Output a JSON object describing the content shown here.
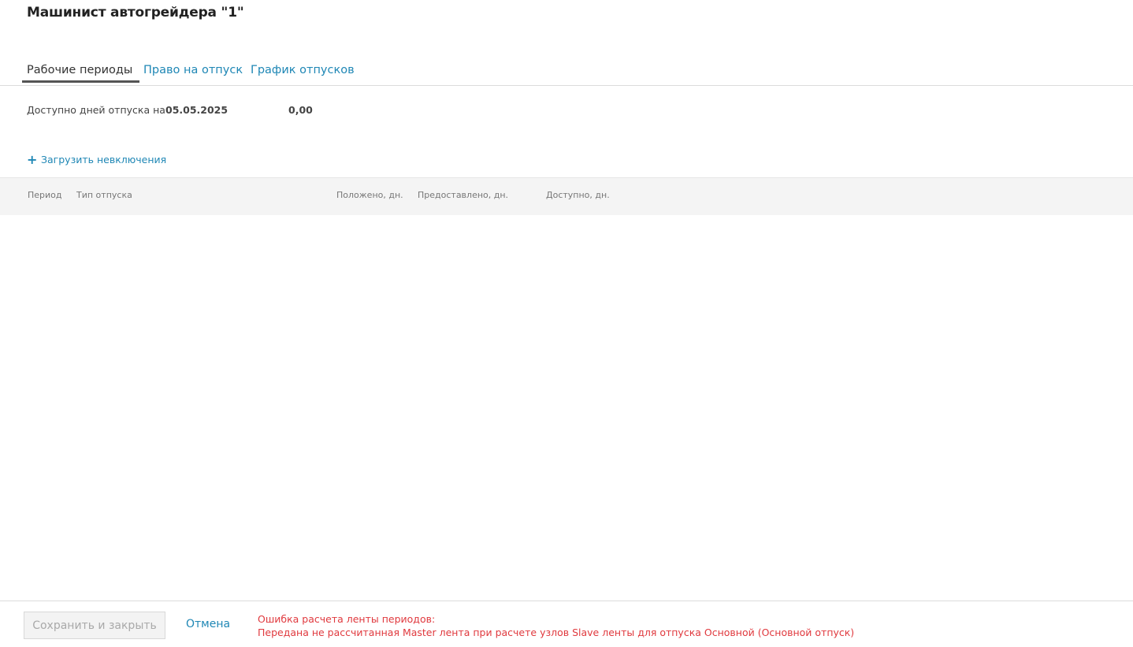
{
  "header": {
    "title": "Машинист автогрейдера \"1\""
  },
  "tabs": [
    {
      "label": "Рабочие периоды",
      "active": true
    },
    {
      "label": "Право на отпуск",
      "active": false
    },
    {
      "label": "График отпусков",
      "active": false
    }
  ],
  "availability": {
    "label": "Доступно дней отпуска на",
    "date": "05.05.2025",
    "value": "0,00"
  },
  "actions": {
    "load_exclusions_label": "Загрузить невключения",
    "load_exclusions_icon": "plus-icon"
  },
  "table": {
    "columns": [
      "Период",
      "Тип отпуска",
      "Положено, дн.",
      "Предоставлено, дн.",
      "Доступно, дн."
    ],
    "rows": []
  },
  "footer": {
    "save_label": "Сохранить и закрыть",
    "save_disabled": true,
    "cancel_label": "Отмена",
    "error_title": "Ошибка расчета ленты периодов:",
    "error_message": "Передана не рассчитанная Master лента при расчете узлов Slave ленты для отпуска Основной (Основной отпуск)"
  },
  "colors": {
    "accent": "#1f87b5",
    "error": "#e0393e",
    "header_bg": "#f4f4f4"
  }
}
